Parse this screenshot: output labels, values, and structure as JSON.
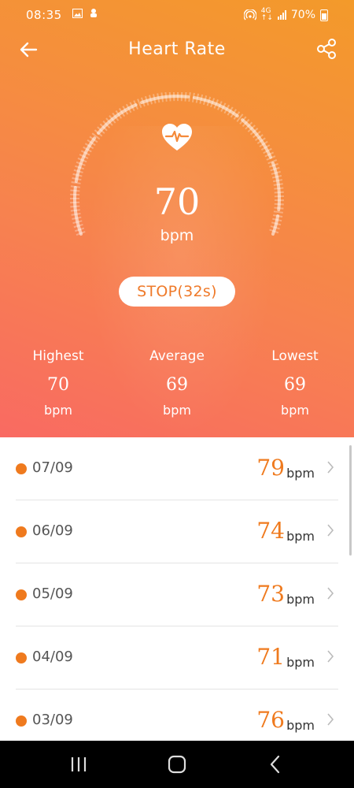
{
  "status_bar": {
    "time": "08:35",
    "battery": "70%"
  },
  "header": {
    "title": "Heart Rate"
  },
  "measurement": {
    "value": "70",
    "unit": "bpm",
    "stop_label": "STOP(32s)"
  },
  "stats": [
    {
      "label": "Highest",
      "value": "70",
      "unit": "bpm"
    },
    {
      "label": "Average",
      "value": "69",
      "unit": "bpm"
    },
    {
      "label": "Lowest",
      "value": "69",
      "unit": "bpm"
    }
  ],
  "history": [
    {
      "date": "07/09",
      "value": "79",
      "unit": "bpm"
    },
    {
      "date": "06/09",
      "value": "74",
      "unit": "bpm"
    },
    {
      "date": "05/09",
      "value": "73",
      "unit": "bpm"
    },
    {
      "date": "04/09",
      "value": "71",
      "unit": "bpm"
    },
    {
      "date": "03/09",
      "value": "76",
      "unit": "bpm"
    }
  ],
  "colors": {
    "accent": "#ef7a1e",
    "gradient_top": "#f39a2a",
    "gradient_bottom": "#f96a62"
  },
  "icons": [
    "back-arrow-icon",
    "share-icon",
    "heart-pulse-icon",
    "chevron-right-icon",
    "recent-apps-icon",
    "home-icon",
    "back-nav-icon"
  ]
}
